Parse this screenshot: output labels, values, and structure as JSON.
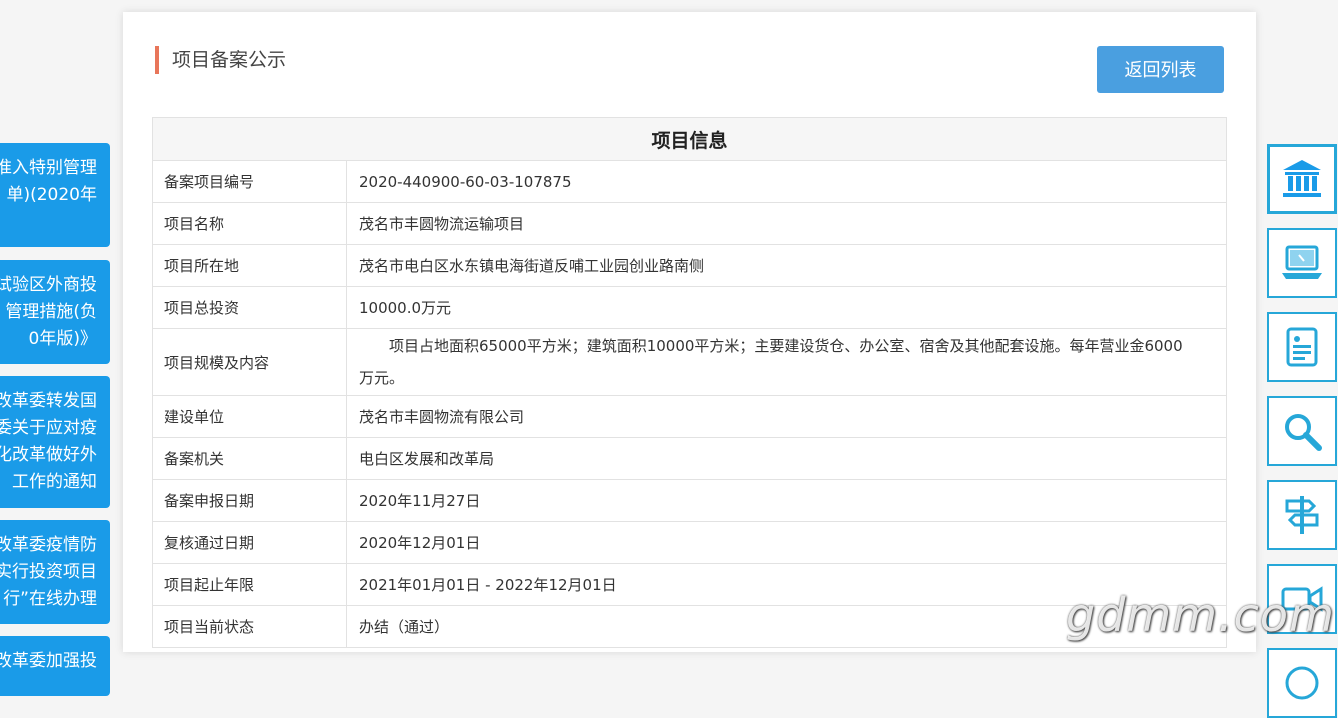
{
  "left_tabs": [
    {
      "lines": [
        "准入特别管理",
        "单)(2020年",
        ""
      ]
    },
    {
      "lines": [
        "试验区外商投",
        "管理措施(负",
        "0年版)》"
      ]
    },
    {
      "lines": [
        "改革委转发国",
        "委关于应对疫",
        "化改革做好外",
        "工作的通知"
      ]
    },
    {
      "lines": [
        "改革委疫情防",
        "实行投资项目",
        "行”在线办理"
      ]
    },
    {
      "lines": [
        "改革委加强投"
      ]
    }
  ],
  "page": {
    "title": "项目备案公示",
    "back_button": "返回列表"
  },
  "table": {
    "header": "项目信息",
    "rows": [
      {
        "label": "备案项目编号",
        "value": "2020-440900-60-03-107875"
      },
      {
        "label": "项目名称",
        "value": "茂名市丰圆物流运输项目"
      },
      {
        "label": "项目所在地",
        "value": "茂名市电白区水东镇电海街道反哺工业园创业路南侧"
      },
      {
        "label": "项目总投资",
        "value": "10000.0万元"
      },
      {
        "label": "项目规模及内容",
        "value": "项目占地面积65000平方米；建筑面积10000平方米；主要建设货仓、办公室、宿舍及其他配套设施。每年营业金6000万元。"
      },
      {
        "label": "建设单位",
        "value": "茂名市丰圆物流有限公司"
      },
      {
        "label": "备案机关",
        "value": "电白区发展和改革局"
      },
      {
        "label": "备案申报日期",
        "value": "2020年11月27日"
      },
      {
        "label": "复核通过日期",
        "value": "2020年12月01日"
      },
      {
        "label": "项目起止年限",
        "value": "2021年01月01日 - 2022年12月01日"
      },
      {
        "label": "项目当前状态",
        "value": "办结（通过）"
      }
    ]
  },
  "right_icons": [
    "bank-icon",
    "laptop-icon",
    "document-icon",
    "search-icon",
    "signpost-icon",
    "video-camera-icon",
    "circle-icon"
  ],
  "watermark": "gdmm.com",
  "colors": {
    "accent_blue": "#1a9be8",
    "button_blue": "#4a9fe0",
    "title_marker": "#e8765a",
    "icon_border": "#26a7d8"
  }
}
